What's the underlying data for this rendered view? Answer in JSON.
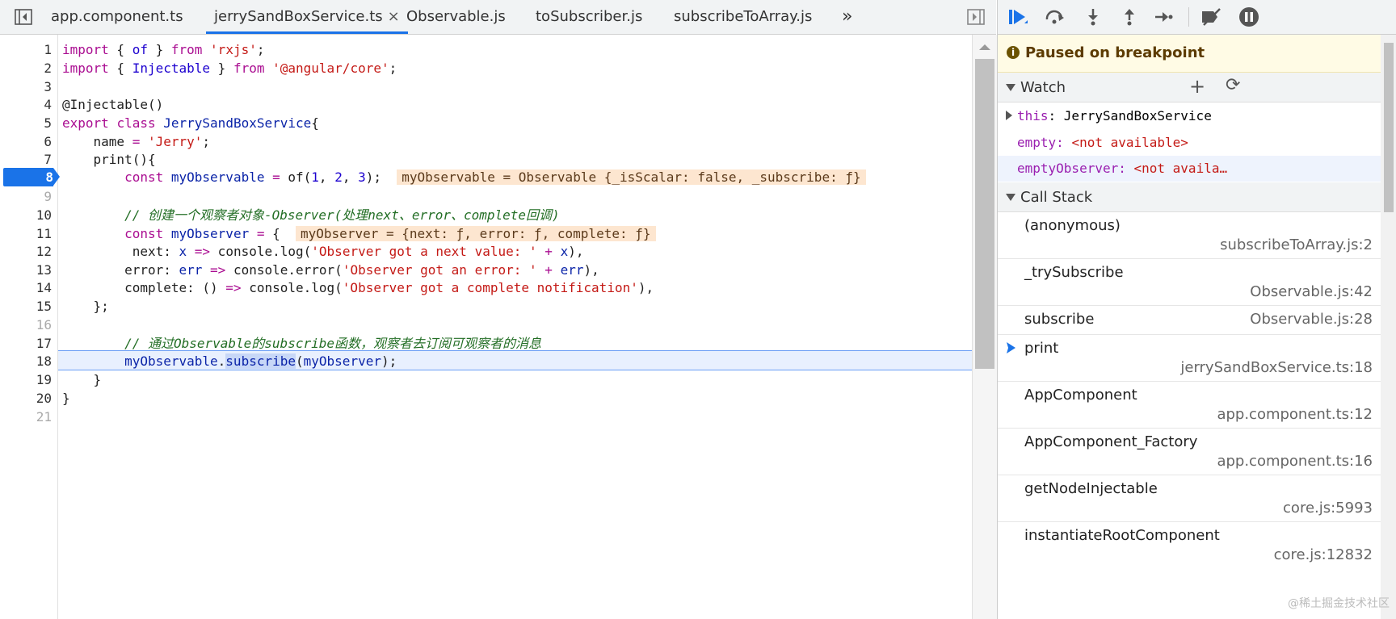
{
  "tabs": [
    {
      "label": "app.component.ts"
    },
    {
      "label": "jerrySandBoxService.ts",
      "active": true,
      "close": "×"
    },
    {
      "label": "Observable.js"
    },
    {
      "label": "toSubscriber.js"
    },
    {
      "label": "subscribeToArray.js"
    }
  ],
  "tabs_more": "»",
  "editor": {
    "breakpoint_line": 8,
    "current_line": 18,
    "line_numbers": [
      "1",
      "2",
      "3",
      "4",
      "5",
      "6",
      "7",
      "8",
      "9",
      "10",
      "11",
      "12",
      "13",
      "14",
      "15",
      "16",
      "17",
      "18",
      "19",
      "20",
      "21"
    ],
    "lines": {
      "l1": {
        "a": "import",
        "b": " { ",
        "c": "of",
        "d": " } ",
        "e": "from",
        "f": " ",
        "g": "'rxjs'",
        "h": ";"
      },
      "l2": {
        "a": "import",
        "b": " { ",
        "c": "Injectable",
        "d": " } ",
        "e": "from",
        "f": " ",
        "g": "'@angular/core'",
        "h": ";"
      },
      "l4": {
        "a": "@Injectable()"
      },
      "l5": {
        "a": "export",
        "b": " ",
        "c": "class",
        "d": " ",
        "e": "JerrySandBoxService",
        "f": "{"
      },
      "l6": {
        "a": "    name ",
        "b": "=",
        "c": " ",
        "d": "'Jerry'",
        "e": ";"
      },
      "l7": {
        "a": "    print(){"
      },
      "l8": {
        "a": "        ",
        "b": "const",
        "c": " ",
        "d": "myObservable",
        "e": " ",
        "f": "=",
        "g": " of(",
        "h": "1",
        "i": ", ",
        "j": "2",
        "k": ", ",
        "l": "3",
        "m": ");",
        "inline": "myObservable = Observable {_isScalar: false, _subscribe: ƒ}"
      },
      "l10": {
        "a": "        // 创建一个观察者对象-Observer(处理next、error、complete回调)"
      },
      "l11": {
        "a": "        ",
        "b": "const",
        "c": " ",
        "d": "myObserver",
        "e": " ",
        "f": "=",
        "g": " {",
        "inline": "myObserver = {next: ƒ, error: ƒ, complete: ƒ}"
      },
      "l12": {
        "a": "         next: ",
        "b": "x",
        "c": " ",
        "d": "=>",
        "e": " console.log(",
        "f": "'Observer got a next value: '",
        "g": " ",
        "h": "+",
        "i": " ",
        "j": "x",
        "k": "),"
      },
      "l13": {
        "a": "        error: ",
        "b": "err",
        "c": " ",
        "d": "=>",
        "e": " console.error(",
        "f": "'Observer got an error: '",
        "g": " ",
        "h": "+",
        "i": " ",
        "j": "err",
        "k": "),"
      },
      "l14": {
        "a": "        complete: () ",
        "b": "=>",
        "c": " console.log(",
        "d": "'Observer got a complete notification'",
        "e": "),"
      },
      "l15": {
        "a": "    };"
      },
      "l17": {
        "a": "        // 通过Observable的subscribe函数，观察者去订阅可观察者的消息"
      },
      "l18": {
        "a": "        ",
        "b": "myObservable",
        "c": ".",
        "d": "subscribe",
        "e": "(",
        "f": "myObserver",
        "g": ");"
      },
      "l19": {
        "a": "    }"
      },
      "l20": {
        "a": "}"
      }
    }
  },
  "debugger": {
    "paused_text": "Paused on breakpoint",
    "watch": {
      "title": "Watch",
      "add": "+",
      "refresh": "⟳",
      "items": [
        {
          "key": "this",
          "sep": ": ",
          "value": "JerrySandBoxService"
        },
        {
          "key": "empty",
          "sep": ": ",
          "value": "<not available>"
        },
        {
          "key": "emptyObserver",
          "sep": ": ",
          "value": "<not availa…"
        }
      ]
    },
    "call_stack": {
      "title": "Call Stack",
      "frames": [
        {
          "fn": "(anonymous)",
          "loc": "subscribeToArray.js:2"
        },
        {
          "fn": "_trySubscribe",
          "loc": "Observable.js:42"
        },
        {
          "fn": "subscribe",
          "loc": "Observable.js:28"
        },
        {
          "fn": "print",
          "loc": "jerrySandBoxService.ts:18"
        },
        {
          "fn": "AppComponent",
          "loc": "app.component.ts:12"
        },
        {
          "fn": "AppComponent_Factory",
          "loc": "app.component.ts:16"
        },
        {
          "fn": "getNodeInjectable",
          "loc": "core.js:5993"
        },
        {
          "fn": "instantiateRootComponent",
          "loc": "core.js:12832"
        }
      ]
    }
  },
  "watermark": "@稀土掘金技术社区",
  "colors": {
    "accent": "#1a73e8",
    "paused_bg": "#fffbe5",
    "inline_bg": "#fde6d0"
  }
}
